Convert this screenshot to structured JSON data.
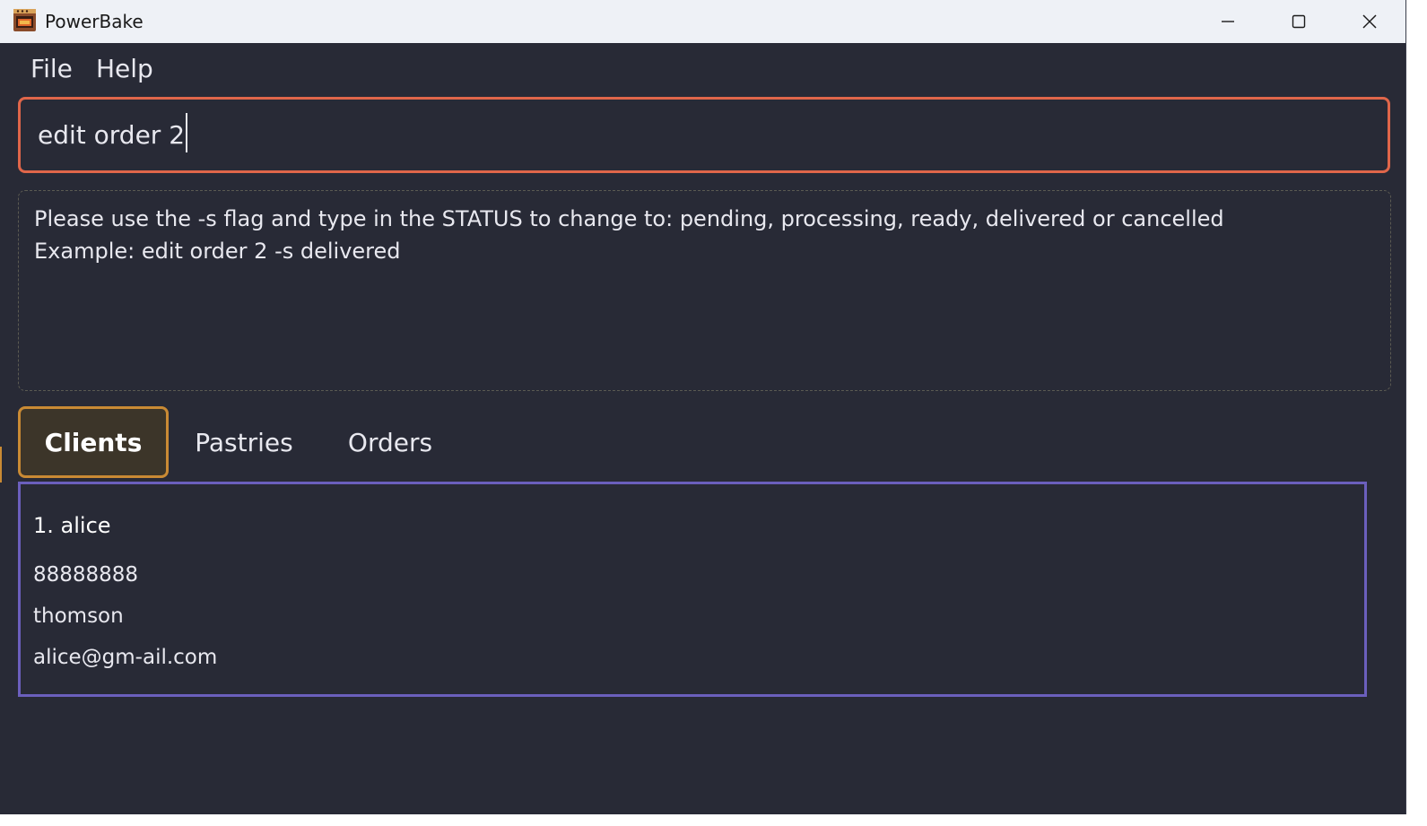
{
  "window": {
    "title": "PowerBake",
    "app_icon": "oven-icon",
    "controls": {
      "minimize_icon": "minimize-icon",
      "maximize_icon": "maximize-icon",
      "close_icon": "close-icon"
    }
  },
  "menu": {
    "file_label": "File",
    "help_label": "Help"
  },
  "command": {
    "value": "edit order 2"
  },
  "result": {
    "line1": "Please use the -s flag and type in the STATUS to change to: pending, processing, ready, delivered or cancelled",
    "line2": "Example: edit order 2 -s delivered"
  },
  "tabs": [
    {
      "label": "Clients",
      "active": true
    },
    {
      "label": "Pastries",
      "active": false
    },
    {
      "label": "Orders",
      "active": false
    }
  ],
  "clients": [
    {
      "header": "1. alice",
      "phone": "88888888",
      "address": "thomson",
      "email": "alice@gm-ail.com"
    }
  ],
  "colors": {
    "background": "#282a36",
    "command_border": "#e0664a",
    "active_tab_border": "#c98a34",
    "list_border": "#6b5fbd"
  }
}
